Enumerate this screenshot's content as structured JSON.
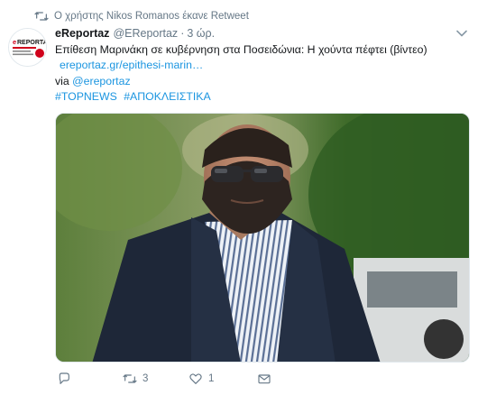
{
  "retweet_context": {
    "text": "Ο χρήστης Nikos Romanos έκανε Retweet"
  },
  "author": {
    "display_name": "eReportaz",
    "handle": "@EReportaz",
    "separator": "·",
    "time": "3 ώρ.",
    "avatar_logo_text": "eREPORTAZ"
  },
  "tweet": {
    "text": "Επίθεση Μαρινάκη σε κυβέρνηση στα Ποσειδώνια: Η χούντα πέφτει (βίντεο)",
    "link_text": "ereportaz.gr/epithesi-marin…",
    "via_prefix": "via",
    "via_mention": "@ereportaz",
    "hashtags": [
      "#TOPNEWS",
      "#ΑΠΟΚΛΕΙΣΤΙΚΑ"
    ]
  },
  "actions": {
    "reply_count": "",
    "retweet_count": "3",
    "like_count": "1",
    "dm_count": ""
  },
  "colors": {
    "link": "#1b95e0",
    "secondary": "#657786",
    "retweeted": "#17bf63"
  }
}
